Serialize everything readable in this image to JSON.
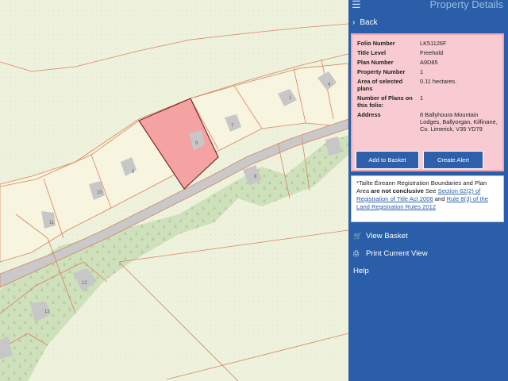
{
  "panel": {
    "title": "Property Details",
    "back_label": "Back",
    "details": [
      {
        "key": "Folio Number",
        "value": "LK51126F"
      },
      {
        "key": "Title Level",
        "value": "Freehold"
      },
      {
        "key": "Plan Number",
        "value": "A9D85"
      },
      {
        "key": "Property Number",
        "value": "1"
      },
      {
        "key": "Area of selected plans",
        "value": "0.11 hectares."
      },
      {
        "key": "Number of Plans on this folio:",
        "value": "1"
      },
      {
        "key": "Address",
        "value": "8 Ballyhoura Mountain Lodges, Ballyorgan, Kilfinane, Co. Limerick, V35 YD79"
      }
    ],
    "add_to_basket_label": "Add to Basket",
    "create_alert_label": "Create Alert",
    "notice": {
      "text1": "*Tailte Éireann Registration Boundaries and Plan Area",
      "bold": "are not conclusive",
      "text2": "See",
      "link1": "Section 62(2) of Registration of Title Act 2006",
      "text3": "and",
      "link2": "Rule 8(3) of the Land Registration Rules 2012"
    },
    "menu": {
      "view_basket": "View Basket",
      "print_view": "Print Current View",
      "help": "Help"
    }
  },
  "map": {
    "plot_labels": [
      "4",
      "1",
      "7",
      "9",
      "9",
      "10",
      "11",
      "8",
      "12",
      "13"
    ],
    "colors": {
      "background": "#eef2dc",
      "boundary": "#d9825e",
      "selected_fill": "#f4a2a2",
      "road": "#c9c9c9",
      "forest": "#cfe0bd",
      "building": "#c7c7c7",
      "panel": "#2b5ea8",
      "card": "#f7cbd1"
    }
  }
}
